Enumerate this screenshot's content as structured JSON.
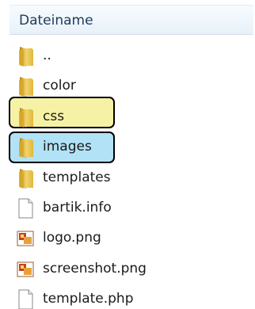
{
  "window": {
    "column_header": "Dateiname"
  },
  "files": [
    {
      "name": "..",
      "icon": "folder-icon",
      "highlight": "none"
    },
    {
      "name": "color",
      "icon": "folder-icon",
      "highlight": "none"
    },
    {
      "name": "css",
      "icon": "folder-icon",
      "highlight": "yellow"
    },
    {
      "name": "images",
      "icon": "folder-icon",
      "highlight": "blue"
    },
    {
      "name": "templates",
      "icon": "folder-icon",
      "highlight": "none"
    },
    {
      "name": "bartik.info",
      "icon": "document-icon",
      "highlight": "none"
    },
    {
      "name": "logo.png",
      "icon": "image-file-icon",
      "highlight": "none"
    },
    {
      "name": "screenshot.png",
      "icon": "image-file-icon",
      "highlight": "none"
    },
    {
      "name": "template.php",
      "icon": "document-icon",
      "highlight": "none"
    }
  ],
  "colors": {
    "header_text": "#1e395b",
    "highlight_yellow": "#f5f2a5",
    "highlight_blue": "#b1e2f6",
    "folder": "#e6c24a",
    "image_icon": "#c8401e"
  }
}
